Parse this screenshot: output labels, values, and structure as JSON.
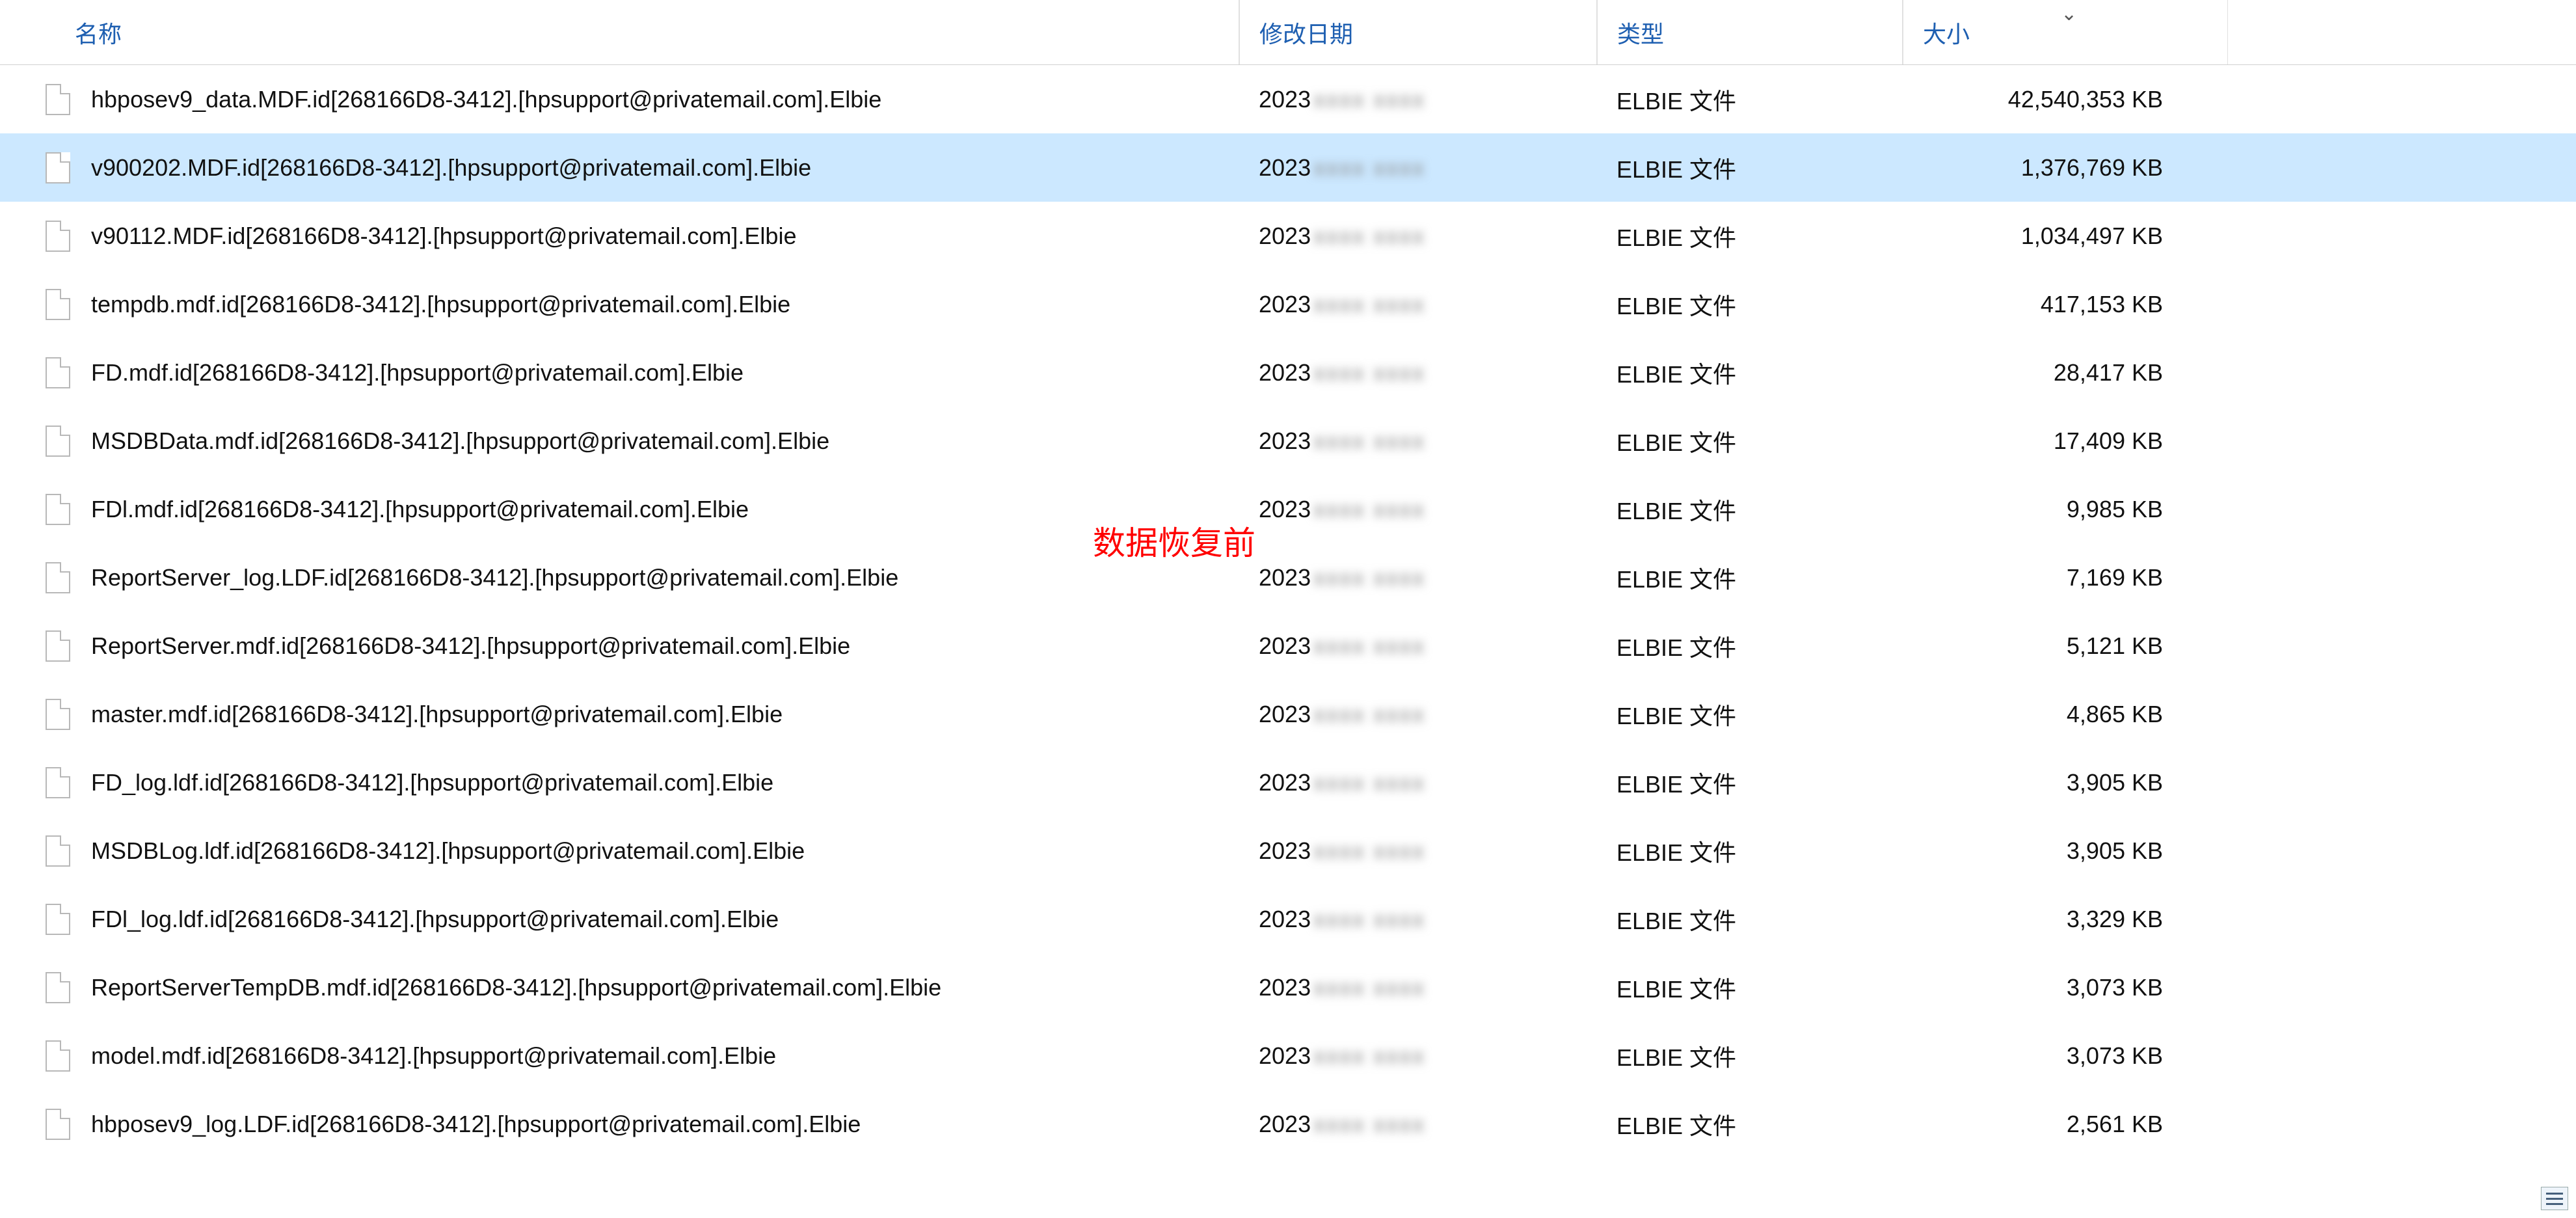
{
  "columns": {
    "name": "名称",
    "date": "修改日期",
    "type": "类型",
    "size": "大小"
  },
  "overlay_text": "数据恢复前",
  "blurred_detail": "xxxx xxxx",
  "files": [
    {
      "name": "hbposev9_data.MDF.id[268166D8-3412].[hpsupport@privatemail.com].Elbie",
      "date_prefix": "2023",
      "type": "ELBIE 文件",
      "size": "42,540,353 KB",
      "selected": false
    },
    {
      "name": "v900202.MDF.id[268166D8-3412].[hpsupport@privatemail.com].Elbie",
      "date_prefix": "2023",
      "type": "ELBIE 文件",
      "size": "1,376,769 KB",
      "selected": true
    },
    {
      "name": "v90112.MDF.id[268166D8-3412].[hpsupport@privatemail.com].Elbie",
      "date_prefix": "2023",
      "type": "ELBIE 文件",
      "size": "1,034,497 KB",
      "selected": false
    },
    {
      "name": "tempdb.mdf.id[268166D8-3412].[hpsupport@privatemail.com].Elbie",
      "date_prefix": "2023",
      "type": "ELBIE 文件",
      "size": "417,153 KB",
      "selected": false
    },
    {
      "name": "FD.mdf.id[268166D8-3412].[hpsupport@privatemail.com].Elbie",
      "date_prefix": "2023",
      "type": "ELBIE 文件",
      "size": "28,417 KB",
      "selected": false
    },
    {
      "name": "MSDBData.mdf.id[268166D8-3412].[hpsupport@privatemail.com].Elbie",
      "date_prefix": "2023",
      "type": "ELBIE 文件",
      "size": "17,409 KB",
      "selected": false
    },
    {
      "name": "FDl.mdf.id[268166D8-3412].[hpsupport@privatemail.com].Elbie",
      "date_prefix": "2023",
      "type": "ELBIE 文件",
      "size": "9,985 KB",
      "selected": false
    },
    {
      "name": "ReportServer_log.LDF.id[268166D8-3412].[hpsupport@privatemail.com].Elbie",
      "date_prefix": "2023",
      "type": "ELBIE 文件",
      "size": "7,169 KB",
      "selected": false
    },
    {
      "name": "ReportServer.mdf.id[268166D8-3412].[hpsupport@privatemail.com].Elbie",
      "date_prefix": "2023",
      "type": "ELBIE 文件",
      "size": "5,121 KB",
      "selected": false
    },
    {
      "name": "master.mdf.id[268166D8-3412].[hpsupport@privatemail.com].Elbie",
      "date_prefix": "2023",
      "type": "ELBIE 文件",
      "size": "4,865 KB",
      "selected": false
    },
    {
      "name": "FD_log.ldf.id[268166D8-3412].[hpsupport@privatemail.com].Elbie",
      "date_prefix": "2023",
      "type": "ELBIE 文件",
      "size": "3,905 KB",
      "selected": false
    },
    {
      "name": "MSDBLog.ldf.id[268166D8-3412].[hpsupport@privatemail.com].Elbie",
      "date_prefix": "2023",
      "type": "ELBIE 文件",
      "size": "3,905 KB",
      "selected": false
    },
    {
      "name": "FDl_log.ldf.id[268166D8-3412].[hpsupport@privatemail.com].Elbie",
      "date_prefix": "2023",
      "type": "ELBIE 文件",
      "size": "3,329 KB",
      "selected": false
    },
    {
      "name": "ReportServerTempDB.mdf.id[268166D8-3412].[hpsupport@privatemail.com].Elbie",
      "date_prefix": "2023",
      "type": "ELBIE 文件",
      "size": "3,073 KB",
      "selected": false
    },
    {
      "name": "model.mdf.id[268166D8-3412].[hpsupport@privatemail.com].Elbie",
      "date_prefix": "2023",
      "type": "ELBIE 文件",
      "size": "3,073 KB",
      "selected": false
    },
    {
      "name": "hbposev9_log.LDF.id[268166D8-3412].[hpsupport@privatemail.com].Elbie",
      "date_prefix": "2023",
      "type": "ELBIE 文件",
      "size": "2,561 KB",
      "selected": false
    }
  ]
}
